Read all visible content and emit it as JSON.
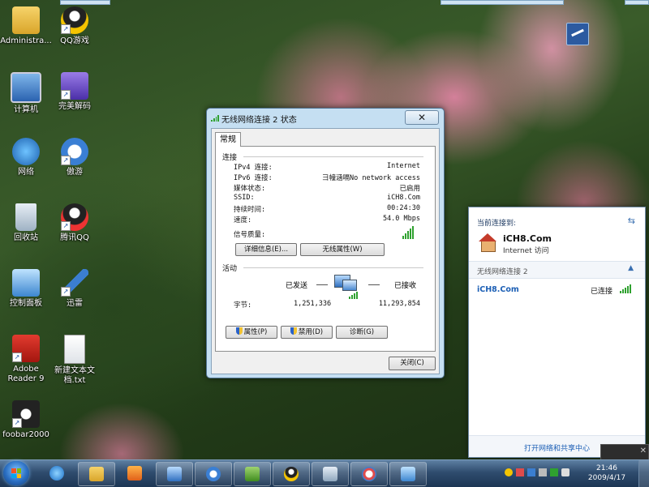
{
  "desktop_icons": [
    {
      "label": "Administra..."
    },
    {
      "label": "QQ游戏"
    },
    {
      "label": "计算机"
    },
    {
      "label": "完美解码"
    },
    {
      "label": "网络"
    },
    {
      "label": "傲游"
    },
    {
      "label": "回收站"
    },
    {
      "label": "腾讯QQ"
    },
    {
      "label": "控制面板"
    },
    {
      "label": "迅雷"
    },
    {
      "label": "Adobe\nReader 9"
    },
    {
      "label": "新建文本文\n档.txt"
    },
    {
      "label": "foobar2000"
    }
  ],
  "dialog": {
    "title": "无线网络连接 2 状态",
    "close": "✕",
    "tab": "常规",
    "connection": {
      "heading": "连接",
      "rows": [
        {
          "key": "IPv4 连接:",
          "value": "Internet"
        },
        {
          "key": "IPv6 连接:",
          "value": "彐幢涵嗝No network access"
        },
        {
          "key": "媒体状态:",
          "value": "已启用"
        },
        {
          "key": "SSID:",
          "value": "iCH8.Com"
        },
        {
          "key": "持续时间:",
          "value": "00:24:30"
        },
        {
          "key": "速度:",
          "value": "54.0 Mbps"
        }
      ],
      "signal_label": "信号质量:",
      "details_button": "详细信息(E)...",
      "wireless_props_button": "无线属性(W)"
    },
    "activity": {
      "heading": "活动",
      "sent_label": "已发送",
      "received_label": "已接收",
      "bytes_label": "字节:",
      "bytes_sent": "1,251,336",
      "bytes_received": "11,293,854"
    },
    "properties_button": "属性(P)",
    "disable_button": "禁用(D)",
    "diagnose_button": "诊断(G)",
    "close_button": "关闭(C)"
  },
  "network_flyout": {
    "header": "当前连接到:",
    "network_name": "iCH8.Com",
    "network_sub": "Internet 访问",
    "group": "无线网络连接 2",
    "ssid": "iCH8.Com",
    "status": "已连接",
    "footer_link": "打开网络和共享中心"
  },
  "taskbar": {
    "time": "21:46",
    "date": "2009/4/17"
  },
  "colors": {
    "accent": "#1c5fb5",
    "signal": "#2fa12f"
  }
}
